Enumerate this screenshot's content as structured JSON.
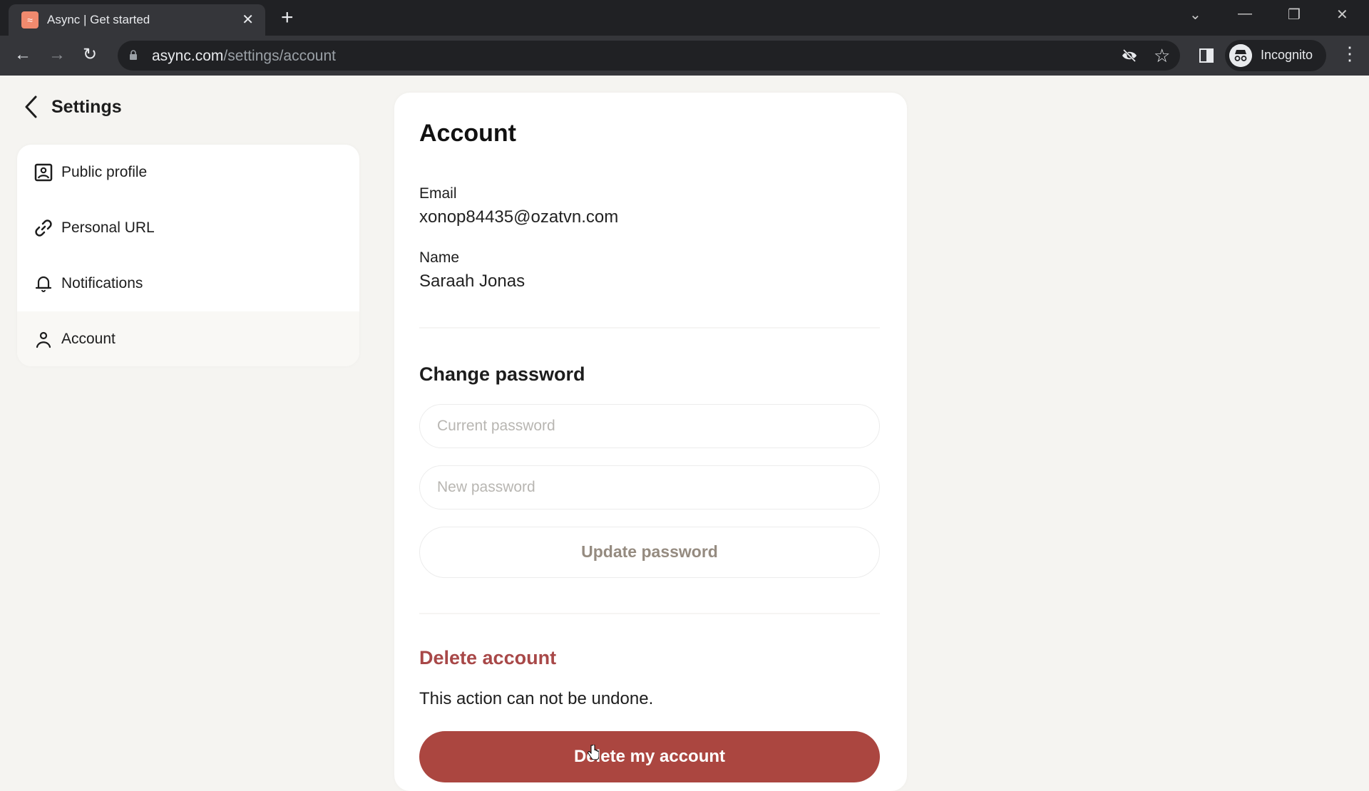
{
  "browser": {
    "tab_title": "Async | Get started",
    "tab_close": "✕",
    "new_tab": "+",
    "url_domain": "async.com",
    "url_path": "/settings/account",
    "profile_label": "Incognito",
    "window_controls": {
      "tab_search": "⌄",
      "minimize": "—",
      "restore": "❐",
      "close": "✕"
    },
    "nav": {
      "back": "←",
      "forward": "→",
      "reload": "↻"
    },
    "icons": {
      "eye_off": "eye-off-icon",
      "star": "☆",
      "side_panel": "side-panel-icon",
      "menu": "⋮"
    }
  },
  "header": {
    "back_title": "Settings"
  },
  "sidebar": {
    "items": [
      {
        "label": "Public profile",
        "icon": "profile-card-icon",
        "active": false
      },
      {
        "label": "Personal URL",
        "icon": "link-icon",
        "active": false
      },
      {
        "label": "Notifications",
        "icon": "bell-icon",
        "active": false
      },
      {
        "label": "Account",
        "icon": "user-icon",
        "active": true
      }
    ]
  },
  "account": {
    "title": "Account",
    "email_label": "Email",
    "email_value": "xonop84435@ozatvn.com",
    "name_label": "Name",
    "name_value": "Saraah Jonas"
  },
  "change_password": {
    "title": "Change password",
    "current_placeholder": "Current password",
    "current_value": "",
    "new_placeholder": "New password",
    "new_value": "",
    "update_button": "Update password"
  },
  "delete_account": {
    "title": "Delete account",
    "warning": "This action can not be undone.",
    "button": "Delete my account"
  },
  "colors": {
    "danger": "#ab4640",
    "danger_text": "#a84848",
    "page_bg": "#f5f4f1",
    "favicon": "#f08a6e"
  }
}
